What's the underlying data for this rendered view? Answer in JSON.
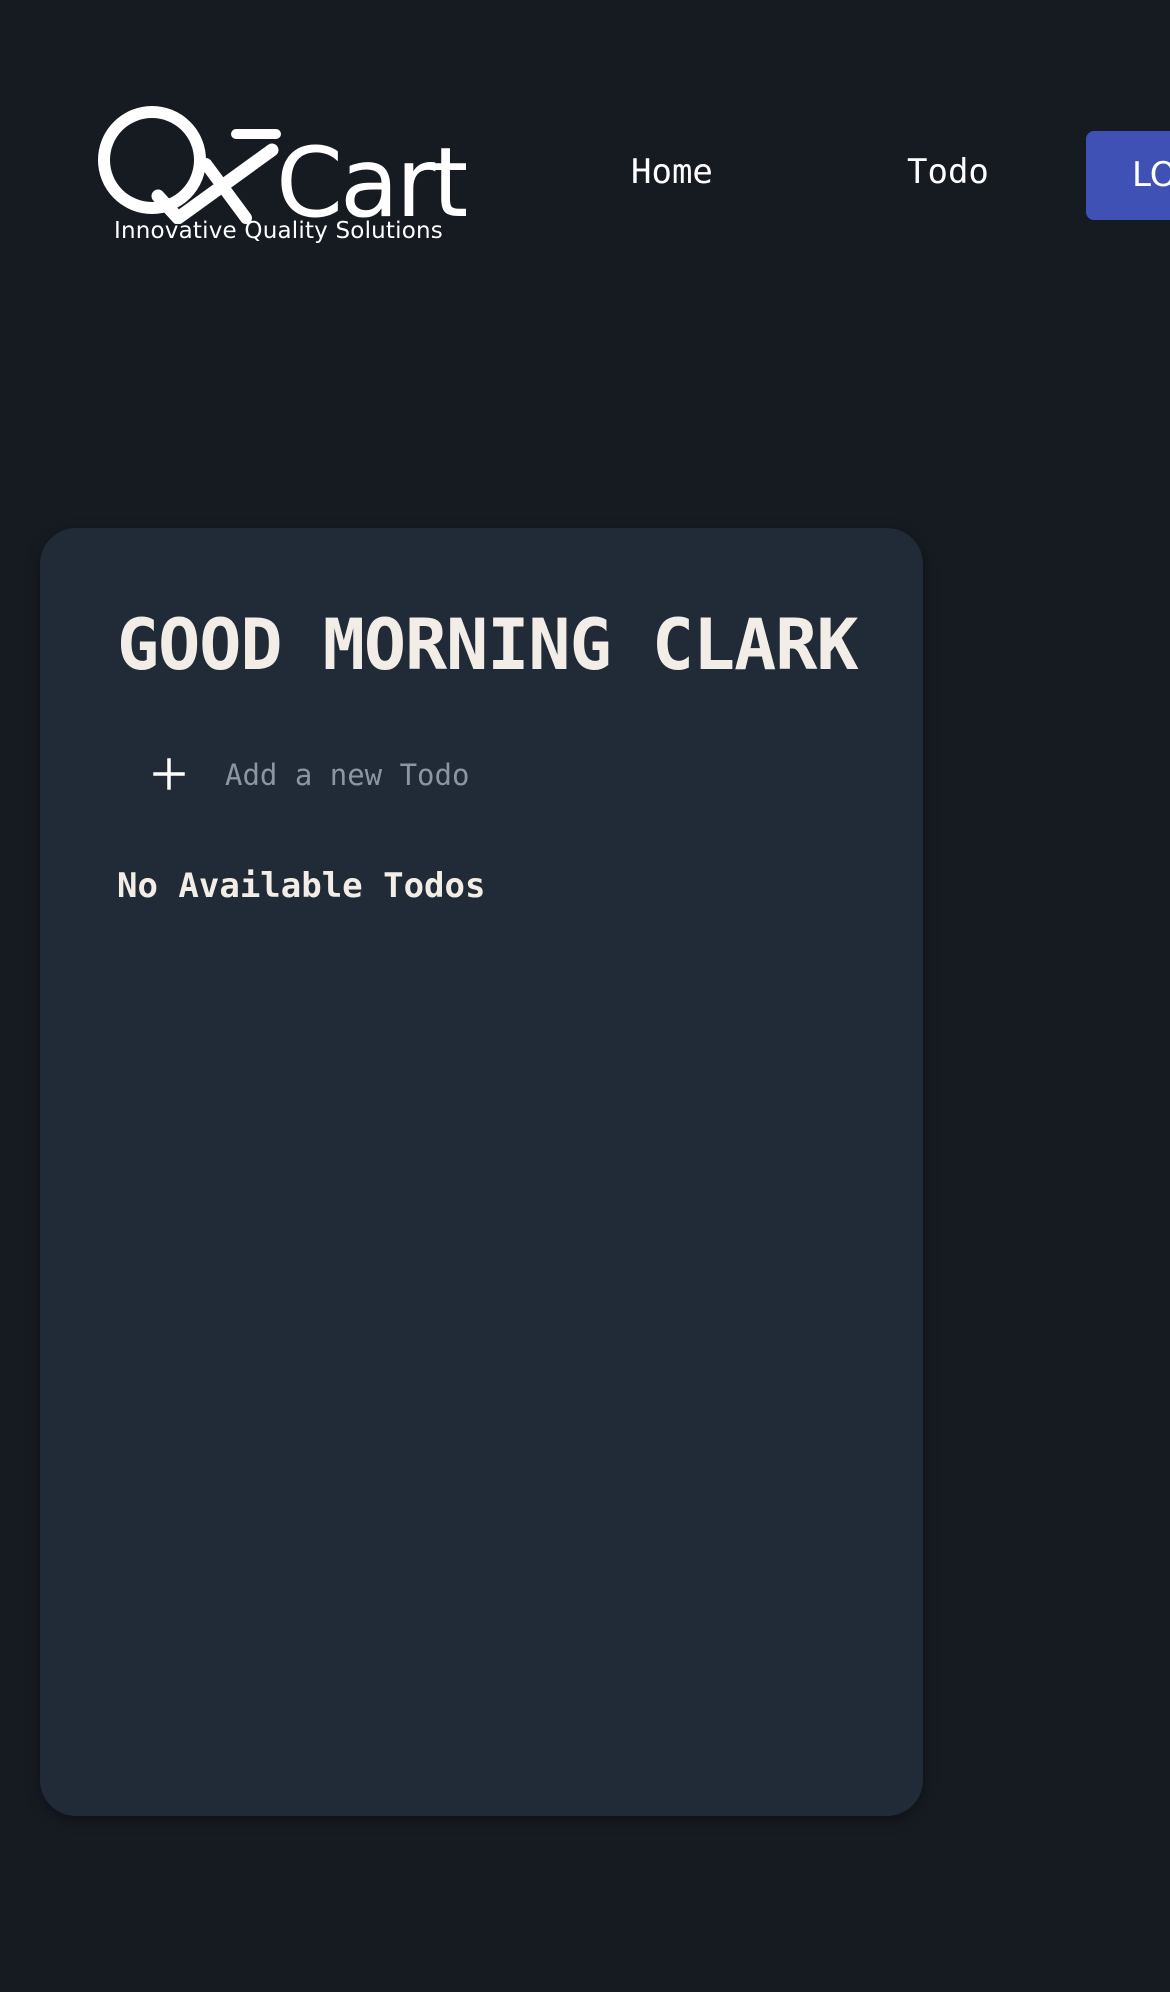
{
  "header": {
    "logo_text": "QACart",
    "logo_tagline": "Innovative Quality Solutions",
    "nav": {
      "home_label": "Home",
      "todo_label": "Todo",
      "logout_label": "LOGOUT"
    }
  },
  "card": {
    "greeting": "GOOD MORNING CLARK",
    "add_todo": {
      "icon": "plus-icon",
      "placeholder": "Add a new Todo",
      "value": ""
    },
    "empty_message": "No Available Todos"
  },
  "colors": {
    "background": "#161b22",
    "card": "#212b37",
    "accent": "#3f51b5",
    "text": "#f2ede6",
    "placeholder": "#8a96a3"
  }
}
